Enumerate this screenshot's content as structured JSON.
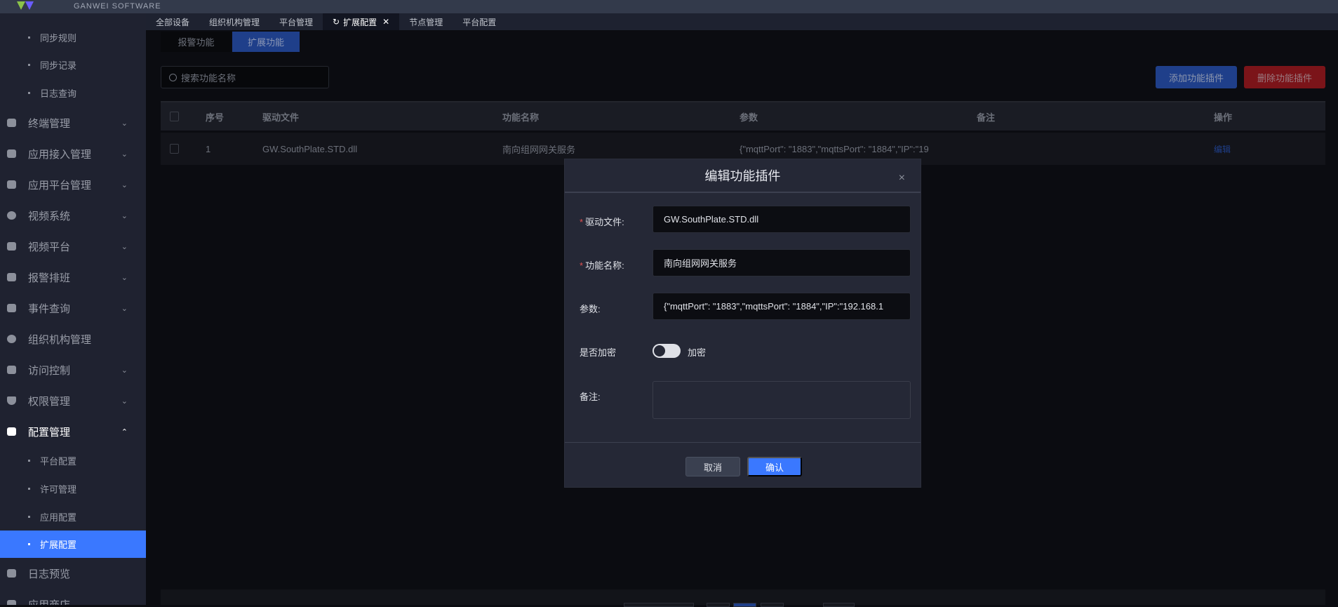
{
  "header": {
    "logo_text": "GANWEI SOFTWARE"
  },
  "sidebar": {
    "sub_top": [
      "同步规则",
      "同步记录",
      "日志查询"
    ],
    "items": [
      {
        "label": "终端管理",
        "icon": "grid-icon",
        "chevron": "⌄"
      },
      {
        "label": "应用接入管理",
        "icon": "grid-icon",
        "chevron": "⌄"
      },
      {
        "label": "应用平台管理",
        "icon": "grid-icon",
        "chevron": "⌄"
      },
      {
        "label": "视频系统",
        "icon": "gear-icon",
        "chevron": "⌄"
      },
      {
        "label": "视频平台",
        "icon": "grid-icon",
        "chevron": "⌄"
      },
      {
        "label": "报警排班",
        "icon": "calendar-icon",
        "chevron": "⌄"
      },
      {
        "label": "事件查询",
        "icon": "search-doc-icon",
        "chevron": "⌄"
      },
      {
        "label": "组织机构管理",
        "icon": "gear-icon",
        "chevron": ""
      },
      {
        "label": "访问控制",
        "icon": "doc-icon",
        "chevron": "⌄"
      },
      {
        "label": "权限管理",
        "icon": "shield-icon",
        "chevron": "⌄"
      },
      {
        "label": "配置管理",
        "icon": "bookmark-icon",
        "chevron": "⌃"
      }
    ],
    "config_sub": [
      "平台配置",
      "许可管理",
      "应用配置",
      "扩展配置"
    ],
    "bottom": [
      "日志预览",
      "应用商店"
    ]
  },
  "tabs": [
    "全部设备",
    "组织机构管理",
    "平台管理",
    "扩展配置",
    "节点管理",
    "平台配置"
  ],
  "subtabs": [
    "报警功能",
    "扩展功能"
  ],
  "search": {
    "placeholder": "搜索功能名称"
  },
  "toolbar": {
    "add": "添加功能插件",
    "delete": "删除功能插件"
  },
  "table": {
    "headers": [
      "序号",
      "驱动文件",
      "功能名称",
      "参数",
      "备注",
      "操作"
    ],
    "rows": [
      {
        "index": "1",
        "driver": "GW.SouthPlate.STD.dll",
        "name": "南向组网网关服务",
        "params": "{\"mqttPort\": \"1883\",\"mqttsPort\": \"1884\",\"IP\":\"19",
        "remark": "",
        "action": "编辑"
      }
    ]
  },
  "modal": {
    "title": "编辑功能插件",
    "close": "×",
    "driver_label": "驱动文件:",
    "driver_value": "GW.SouthPlate.STD.dll",
    "name_label": "功能名称:",
    "name_value": "南向组网网关服务",
    "params_label": "参数:",
    "params_value": "{\"mqttPort\": \"1883\",\"mqttsPort\": \"1884\",\"IP\":\"192.168.1",
    "encrypt_label": "是否加密",
    "encrypt_text": "加密",
    "encrypt_on": false,
    "remark_label": "备注:",
    "remark_value": "",
    "cancel": "取消",
    "confirm": "确认"
  }
}
